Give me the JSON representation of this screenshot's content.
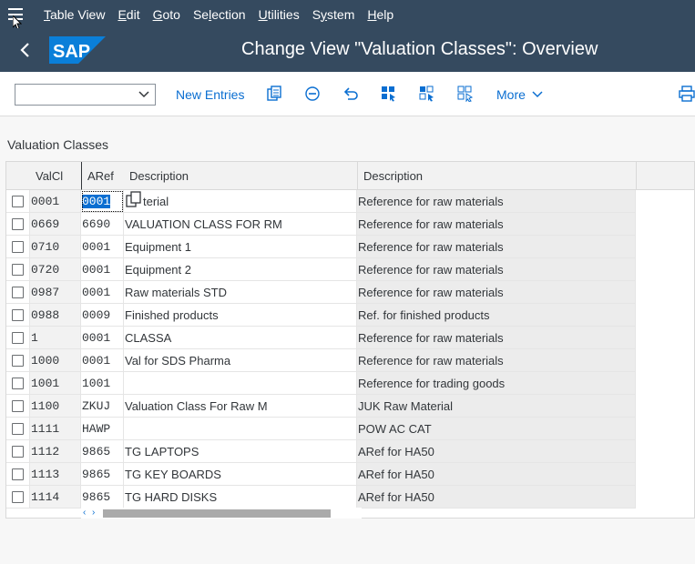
{
  "menubar": {
    "items": [
      {
        "pre": "",
        "u": "T",
        "post": "able View"
      },
      {
        "pre": "",
        "u": "E",
        "post": "dit"
      },
      {
        "pre": "",
        "u": "G",
        "post": "oto"
      },
      {
        "pre": "Se",
        "u": "l",
        "post": "ection"
      },
      {
        "pre": "",
        "u": "U",
        "post": "tilities"
      },
      {
        "pre": "S",
        "u": "y",
        "post": "stem"
      },
      {
        "pre": "",
        "u": "H",
        "post": "elp"
      }
    ]
  },
  "titlebar": {
    "logo_text": "SAP",
    "title": "Change View \"Valuation Classes\": Overview"
  },
  "toolbar": {
    "command_value": "",
    "new_entries": "New Entries",
    "more": "More"
  },
  "section_title": "Valuation Classes",
  "table": {
    "headers": [
      "ValCl",
      "ARef",
      "Description",
      "Description"
    ],
    "rows": [
      {
        "valcl": "0001",
        "aref": "0001",
        "desc": "terial",
        "desc2": "Reference for raw materials"
      },
      {
        "valcl": "0669",
        "aref": "6690",
        "desc": "VALUATION CLASS FOR RM",
        "desc2": "Reference for raw materials"
      },
      {
        "valcl": "0710",
        "aref": "0001",
        "desc": "Equipment 1",
        "desc2": "Reference for raw materials"
      },
      {
        "valcl": "0720",
        "aref": "0001",
        "desc": "Equipment 2",
        "desc2": "Reference for raw materials"
      },
      {
        "valcl": "0987",
        "aref": "0001",
        "desc": "Raw materials STD",
        "desc2": "Reference for raw materials"
      },
      {
        "valcl": "0988",
        "aref": "0009",
        "desc": "Finished products",
        "desc2": "Ref. for finished products"
      },
      {
        "valcl": "1",
        "aref": "0001",
        "desc": "CLASSA",
        "desc2": "Reference for raw materials"
      },
      {
        "valcl": "1000",
        "aref": "0001",
        "desc": "Val for SDS Pharma",
        "desc2": "Reference for raw materials"
      },
      {
        "valcl": "1001",
        "aref": "1001",
        "desc": "",
        "desc2": "Reference for trading goods"
      },
      {
        "valcl": "1100",
        "aref": "ZKUJ",
        "desc": "Valuation Class For Raw M",
        "desc2": "JUK Raw Material"
      },
      {
        "valcl": "1111",
        "aref": "HAWP",
        "desc": "",
        "desc2": "POW AC CAT"
      },
      {
        "valcl": "1112",
        "aref": "9865",
        "desc": "TG LAPTOPS",
        "desc2": "ARef for HA50"
      },
      {
        "valcl": "1113",
        "aref": "9865",
        "desc": "TG KEY BOARDS",
        "desc2": "ARef for HA50"
      },
      {
        "valcl": "1114",
        "aref": "9865",
        "desc": "TG HARD DISKS",
        "desc2": "ARef for HA50"
      }
    ]
  },
  "colors": {
    "shell": "#354a5f",
    "accent": "#0a6ed1",
    "logo": "#0a7fd9"
  }
}
